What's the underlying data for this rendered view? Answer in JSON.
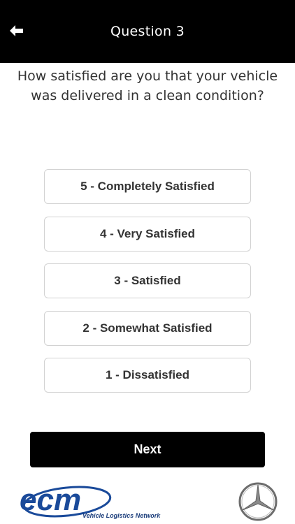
{
  "header": {
    "title": "Question 3",
    "back_icon": "arrow-left-icon"
  },
  "question": {
    "text": "How satisfied are you that your vehicle was delivered in a clean condition?"
  },
  "options": [
    {
      "label": "5 - Completely Satisfied"
    },
    {
      "label": "4 - Very Satisfied"
    },
    {
      "label": "3 - Satisfied"
    },
    {
      "label": "2 - Somewhat Satisfied"
    },
    {
      "label": "1 - Dissatisfied"
    }
  ],
  "next_button": {
    "label": "Next"
  },
  "footer": {
    "ecm_logo_text": "ecm",
    "ecm_tagline": "Vehicle Logistics Network",
    "brand_logo": "mercedes-benz-star-icon",
    "colors": {
      "ecm_blue": "#1a4a9a",
      "header_bg": "#000000"
    }
  }
}
